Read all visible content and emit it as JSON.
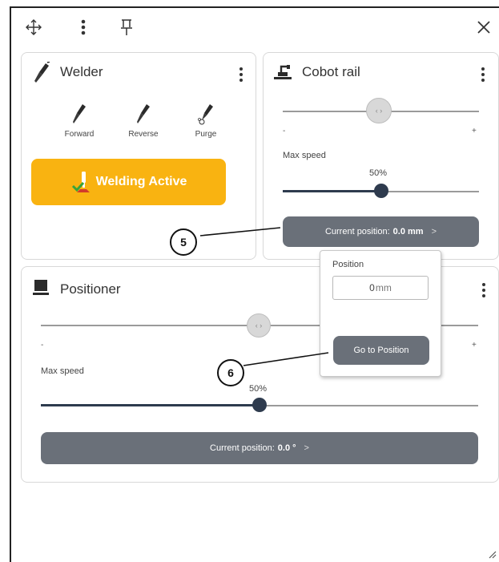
{
  "window": {
    "icons": [
      "move-icon",
      "more-vertical-icon",
      "pin-icon",
      "close-icon"
    ]
  },
  "welder": {
    "title": "Welder",
    "buttons": [
      {
        "label": "Forward",
        "icon": "torch-forward-icon"
      },
      {
        "label": "Reverse",
        "icon": "torch-reverse-icon"
      },
      {
        "label": "Purge",
        "icon": "torch-purge-icon"
      }
    ],
    "status_label": "Welding Active",
    "accent_color": "#f9b311"
  },
  "cobot_rail": {
    "title": "Cobot rail",
    "jog_minus": "-",
    "jog_plus": "+",
    "max_speed_label": "Max speed",
    "speed_value": "50%",
    "speed_fraction": 0.5,
    "position_prefix": "Current position:",
    "position_value": "0.0 mm"
  },
  "position_popover": {
    "label": "Position",
    "input_value": "0",
    "input_unit": "mm",
    "go_button": "Go to Position"
  },
  "positioner": {
    "title": "Positioner",
    "jog_minus": "-",
    "jog_plus": "+",
    "max_speed_label": "Max speed",
    "speed_value": "50%",
    "speed_fraction": 0.5,
    "position_prefix": "Current position:",
    "position_value": "0.0 °"
  },
  "callouts": [
    "5",
    "6"
  ],
  "colors": {
    "slider_dark": "#2e3b4e",
    "button_gray": "#6a7079"
  }
}
